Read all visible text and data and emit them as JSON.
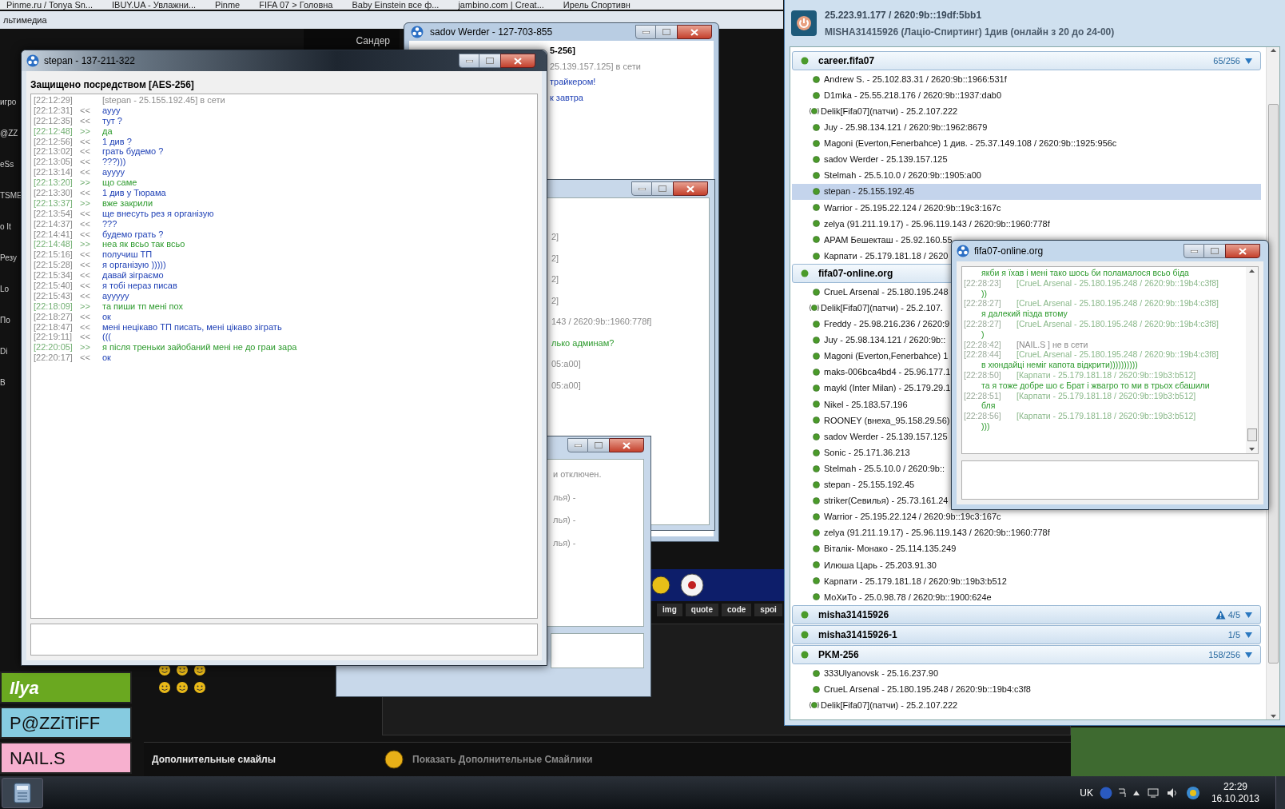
{
  "browser_tabs": [
    "Pinme.ru / Tonya Sn...",
    "IBUY.UA - Увлажни...",
    "Pinme",
    "FIFA 07 > Головна",
    "Baby Einstein все ф...",
    "jambino.com | Creat...",
    "Ирель Спортивн"
  ],
  "menu_fragment": "льтимедиа",
  "page_header_fragment": "Сандер",
  "left_fragments": [
    "игро",
    "@ZZ",
    "eSs",
    "TSME",
    "o It",
    "Резу",
    "Lo",
    "По",
    "Di",
    "B"
  ],
  "editor_buttons": [
    "img",
    "quote",
    "code",
    "spoi"
  ],
  "user_buttons": [
    {
      "name": "Ilya",
      "color": "#6aa820"
    },
    {
      "name": "P@ZZiTiFF",
      "color": "#86cbe0"
    },
    {
      "name": "NAIL.S",
      "color": "#f7b0cf"
    }
  ],
  "extra_smileys_label": "Дополнительные смайлы",
  "show_smileys_link": "Показать Дополнительные Смайлики",
  "window_sadov": {
    "title": "sadov Werder - 127-703-855",
    "lines": [
      {
        "kind": "header",
        "text": "5-256]"
      },
      {
        "kind": "system",
        "text": "25.139.157.125] в сети"
      },
      {
        "kind": "in",
        "text": "трайкером!"
      },
      {
        "kind": "in",
        "text": "к завтра"
      }
    ]
  },
  "window_back": {
    "lines": [
      {
        "kind": "system",
        "text": "2]"
      },
      {
        "kind": "system",
        "text": "2]"
      },
      {
        "kind": "system",
        "text": "2]"
      },
      {
        "kind": "system",
        "text": "2]"
      },
      {
        "kind": "system",
        "text": "143 / 2620:9b::1960:778f]"
      },
      {
        "kind": "out",
        "text": "лько админам?"
      },
      {
        "kind": "system",
        "text": "05:a00]"
      },
      {
        "kind": "system",
        "text": "05:a00]"
      }
    ]
  },
  "window_third": {
    "lines": [
      {
        "kind": "system",
        "text": "и отключен."
      },
      {
        "kind": "system",
        "text": "лья) -"
      },
      {
        "kind": "system",
        "text": "лья) -"
      },
      {
        "kind": "system",
        "text": "лья) -"
      }
    ]
  },
  "window_stepan": {
    "title": "stepan - 137-211-322",
    "security": "Защищено посредством [AES-256]",
    "messages": [
      {
        "time": "[22:12:29]",
        "kind": "system",
        "text": "[stepan - 25.155.192.45] в сети"
      },
      {
        "time": "[22:12:31]",
        "kind": "in",
        "dir": "<<",
        "text": "аууу"
      },
      {
        "time": "[22:12:35]",
        "kind": "in",
        "dir": "<<",
        "text": "тут ?"
      },
      {
        "time": "[22:12:48]",
        "kind": "out",
        "dir": ">>",
        "text": "да"
      },
      {
        "time": "[22:12:56]",
        "kind": "in",
        "dir": "<<",
        "text": "1 див ?"
      },
      {
        "time": "[22:13:02]",
        "kind": "in",
        "dir": "<<",
        "text": "грать будемо ?"
      },
      {
        "time": "[22:13:05]",
        "kind": "in",
        "dir": "<<",
        "text": "???)))"
      },
      {
        "time": "[22:13:14]",
        "kind": "in",
        "dir": "<<",
        "text": "ауууу"
      },
      {
        "time": "[22:13:20]",
        "kind": "out",
        "dir": ">>",
        "text": "що саме"
      },
      {
        "time": "[22:13:30]",
        "kind": "in",
        "dir": "<<",
        "text": "1 див у Тюрама"
      },
      {
        "time": "[22:13:37]",
        "kind": "out",
        "dir": ">>",
        "text": "вже закрили"
      },
      {
        "time": "[22:13:54]",
        "kind": "in",
        "dir": "<<",
        "text": "ще внесуть рез я організую"
      },
      {
        "time": "[22:14:37]",
        "kind": "in",
        "dir": "<<",
        "text": "???"
      },
      {
        "time": "[22:14:41]",
        "kind": "in",
        "dir": "<<",
        "text": "будемо грать ?"
      },
      {
        "time": "[22:14:48]",
        "kind": "out",
        "dir": ">>",
        "text": "неа як всьо так всьо"
      },
      {
        "time": "[22:15:16]",
        "kind": "in",
        "dir": "<<",
        "text": "получиш ТП"
      },
      {
        "time": "[22:15:28]",
        "kind": "in",
        "dir": "<<",
        "text": "я організую )))))"
      },
      {
        "time": "[22:15:34]",
        "kind": "in",
        "dir": "<<",
        "text": "давай зіграємо"
      },
      {
        "time": "[22:15:40]",
        "kind": "in",
        "dir": "<<",
        "text": "я тобі нераз писав"
      },
      {
        "time": "[22:15:43]",
        "kind": "in",
        "dir": "<<",
        "text": "аууууу"
      },
      {
        "time": "[22:18:09]",
        "kind": "out",
        "dir": ">>",
        "text": "та пиши тп мені пох"
      },
      {
        "time": "[22:18:27]",
        "kind": "in",
        "dir": "<<",
        "text": "ок"
      },
      {
        "time": "[22:18:47]",
        "kind": "in",
        "dir": "<<",
        "text": "мені нецікаво ТП писать, мені цікаво зіграть"
      },
      {
        "time": "[22:19:11]",
        "kind": "in",
        "dir": "<<",
        "text": "((("
      },
      {
        "time": "[22:20:05]",
        "kind": "out",
        "dir": ">>",
        "text": "я після треньки зайобаний мені не до граи зара"
      },
      {
        "time": "[22:20:17]",
        "kind": "in",
        "dir": "<<",
        "text": "ок"
      }
    ]
  },
  "network_panel": {
    "address": "25.223.91.177 / 2620:9b::19df:5bb1",
    "nickname": "MISHA31415926 (Лаціо-Спиртинг) 1див (онлайн з 20 до 24-00)",
    "groups": [
      {
        "name": "career.fifa07",
        "count": "65/256",
        "warning": false,
        "expanded": true,
        "members": [
          {
            "text": "Andrew S. - 25.102.83.31 / 2620:9b::1966:531f",
            "relayed": false,
            "selected": false
          },
          {
            "text": "D1mka - 25.55.218.176 / 2620:9b::1937:dab0",
            "relayed": false,
            "selected": false
          },
          {
            "text": "Delik[Fifa07](патчи) - 25.2.107.222",
            "relayed": true,
            "selected": false
          },
          {
            "text": "Juy - 25.98.134.121 / 2620:9b::1962:8679",
            "relayed": false,
            "selected": false
          },
          {
            "text": "Magoni (Everton,Fenerbahce) 1 див. - 25.37.149.108 / 2620:9b::1925:956c",
            "relayed": false,
            "selected": false
          },
          {
            "text": "sadov Werder - 25.139.157.125",
            "relayed": false,
            "selected": false
          },
          {
            "text": "Stelmah - 25.5.10.0 / 2620:9b::1905:a00",
            "relayed": false,
            "selected": false
          },
          {
            "text": "stepan - 25.155.192.45",
            "relayed": false,
            "selected": true
          },
          {
            "text": "Warrior - 25.195.22.124 / 2620:9b::19c3:167c",
            "relayed": false,
            "selected": false
          },
          {
            "text": "zelya (91.211.19.17) - 25.96.119.143 / 2620:9b::1960:778f",
            "relayed": false,
            "selected": false
          },
          {
            "text": "АРАМ Бешекташ - 25.92.160.55",
            "relayed": false,
            "selected": false
          },
          {
            "text": "Карпати - 25.179.181.18 / 2620",
            "relayed": false,
            "selected": false
          }
        ]
      },
      {
        "name": "fifa07-online.org",
        "expanded": true,
        "warning": false,
        "members": [
          {
            "text": "CrueL Arsenal - 25.180.195.248",
            "relayed": false,
            "selected": false
          },
          {
            "text": "Delik[Fifa07](патчи) - 25.2.107.",
            "relayed": true,
            "selected": false
          },
          {
            "text": "Freddy - 25.98.216.236 / 2620:9",
            "relayed": false,
            "selected": false
          },
          {
            "text": "Juy - 25.98.134.121 / 2620:9b::",
            "relayed": false,
            "selected": false
          },
          {
            "text": "Magoni (Everton,Fenerbahce) 1",
            "relayed": false,
            "selected": false
          },
          {
            "text": "maks-006bca4bd4 - 25.96.177.1",
            "relayed": false,
            "selected": false
          },
          {
            "text": "maykl (Inter Milan) - 25.179.29.1",
            "relayed": false,
            "selected": false
          },
          {
            "text": "Nikel - 25.183.57.196",
            "relayed": false,
            "selected": false
          },
          {
            "text": "ROONEY (внеха_95.158.29.56)",
            "relayed": false,
            "selected": false
          },
          {
            "text": "sadov Werder - 25.139.157.125",
            "relayed": false,
            "selected": false
          },
          {
            "text": "Sonic - 25.171.36.213",
            "relayed": false,
            "selected": false
          },
          {
            "text": "Stelmah - 25.5.10.0 / 2620:9b::",
            "relayed": false,
            "selected": false
          },
          {
            "text": "stepan - 25.155.192.45",
            "relayed": false,
            "selected": false
          },
          {
            "text": "striker(Севилья) - 25.73.161.24",
            "relayed": false,
            "selected": false
          },
          {
            "text": "Warrior - 25.195.22.124 / 2620:9b::19c3:167c",
            "relayed": false,
            "selected": false
          },
          {
            "text": "zelya (91.211.19.17) - 25.96.119.143 / 2620:9b::1960:778f",
            "relayed": false,
            "selected": false
          },
          {
            "text": "Віталік- Монако - 25.114.135.249",
            "relayed": false,
            "selected": false
          },
          {
            "text": "Илюша Царь - 25.203.91.30",
            "relayed": false,
            "selected": false
          },
          {
            "text": "Карпати - 25.179.181.18 / 2620:9b::19b3:b512",
            "relayed": false,
            "selected": false
          },
          {
            "text": "МоХиТо - 25.0.98.78 / 2620:9b::1900:624e",
            "relayed": false,
            "selected": false
          }
        ]
      },
      {
        "name": "misha31415926",
        "count": "4/5",
        "warning": true,
        "expanded": false
      },
      {
        "name": "misha31415926-1",
        "count": "1/5",
        "warning": false,
        "expanded": false
      },
      {
        "name": "PKM-256",
        "count": "158/256",
        "warning": false,
        "expanded": true,
        "members": [
          {
            "text": "333Ulyanovsk - 25.16.237.90",
            "relayed": false,
            "selected": false
          },
          {
            "text": "CrueL Arsenal - 25.180.195.248 / 2620:9b::19b4:c3f8",
            "relayed": false,
            "selected": false
          },
          {
            "text": "Delik[Fifa07](патчи) - 25.2.107.222",
            "relayed": true,
            "selected": false
          }
        ]
      }
    ]
  },
  "window_group_chat": {
    "title": "fifa07-online.org",
    "lines": [
      {
        "kind": "message",
        "text": "якби я їхав і мені тако шось би поламалося всьо біда"
      },
      {
        "kind": "sender",
        "time": "[22:28:23]",
        "text": "[CrueL Arsenal - 25.180.195.248 / 2620:9b::19b4:c3f8]"
      },
      {
        "kind": "message",
        "text": "))"
      },
      {
        "kind": "sender",
        "time": "[22:28:27]",
        "text": "[CrueL Arsenal - 25.180.195.248 / 2620:9b::19b4:c3f8]"
      },
      {
        "kind": "message",
        "text": "я далекий пізда втому"
      },
      {
        "kind": "sender",
        "time": "[22:28:27]",
        "text": "[CrueL Arsenal - 25.180.195.248 / 2620:9b::19b4:c3f8]"
      },
      {
        "kind": "message",
        "text": ")"
      },
      {
        "kind": "status",
        "time": "[22:28:42]",
        "text": "[NAIL.S   ] не в сети"
      },
      {
        "kind": "sender",
        "time": "[22:28:44]",
        "text": "[CrueL Arsenal - 25.180.195.248 / 2620:9b::19b4:c3f8]"
      },
      {
        "kind": "message",
        "text": "в хюндайці неміг капота відкрити))))))))))"
      },
      {
        "kind": "sender",
        "time": "[22:28:50]",
        "text": "[Карпати - 25.179.181.18 / 2620:9b::19b3:b512]"
      },
      {
        "kind": "message",
        "text": "та я тоже добре шо є Брат і жвагро то ми в трьох єбашили"
      },
      {
        "kind": "sender",
        "time": "[22:28:51]",
        "text": "[Карпати - 25.179.181.18 / 2620:9b::19b3:b512]"
      },
      {
        "kind": "message",
        "text": "бля"
      },
      {
        "kind": "sender",
        "time": "[22:28:56]",
        "text": "[Карпати - 25.179.181.18 / 2620:9b::19b3:b512]"
      },
      {
        "kind": "message",
        "text": ")))"
      }
    ]
  },
  "taskbar": {
    "language": "UK",
    "time": "22:29",
    "date": "16.10.2013"
  }
}
